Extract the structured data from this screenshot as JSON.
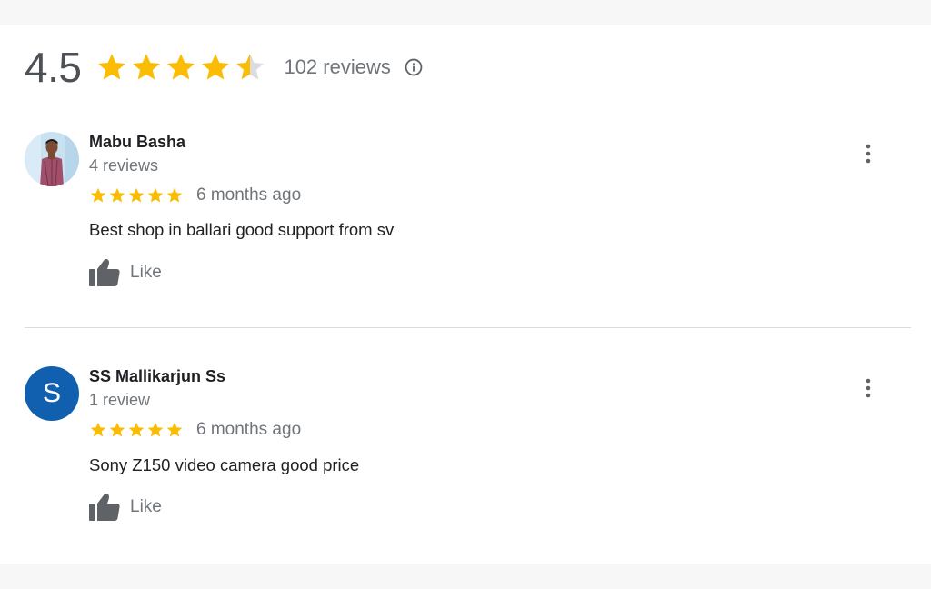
{
  "summary": {
    "rating": "4.5",
    "rating_stars": 4.5,
    "review_count_label": "102 reviews",
    "info_icon": "info-circle-icon"
  },
  "colors": {
    "star": "#fbbc04",
    "star_empty": "#dadce0",
    "avatar_letter_bg": "#1160b0",
    "muted_text": "#70757a"
  },
  "reviews": [
    {
      "name": "Mabu Basha",
      "meta": "4 reviews",
      "stars": 5,
      "date": "6 months ago",
      "text": "Best shop in ballari good support from sv",
      "like_label": "Like",
      "avatar_type": "photo"
    },
    {
      "name": "SS Mallikarjun Ss",
      "meta": "1 review",
      "stars": 5,
      "date": "6 months ago",
      "text": "Sony Z150 video camera good price",
      "like_label": "Like",
      "avatar_type": "letter",
      "avatar_letter": "S"
    }
  ]
}
